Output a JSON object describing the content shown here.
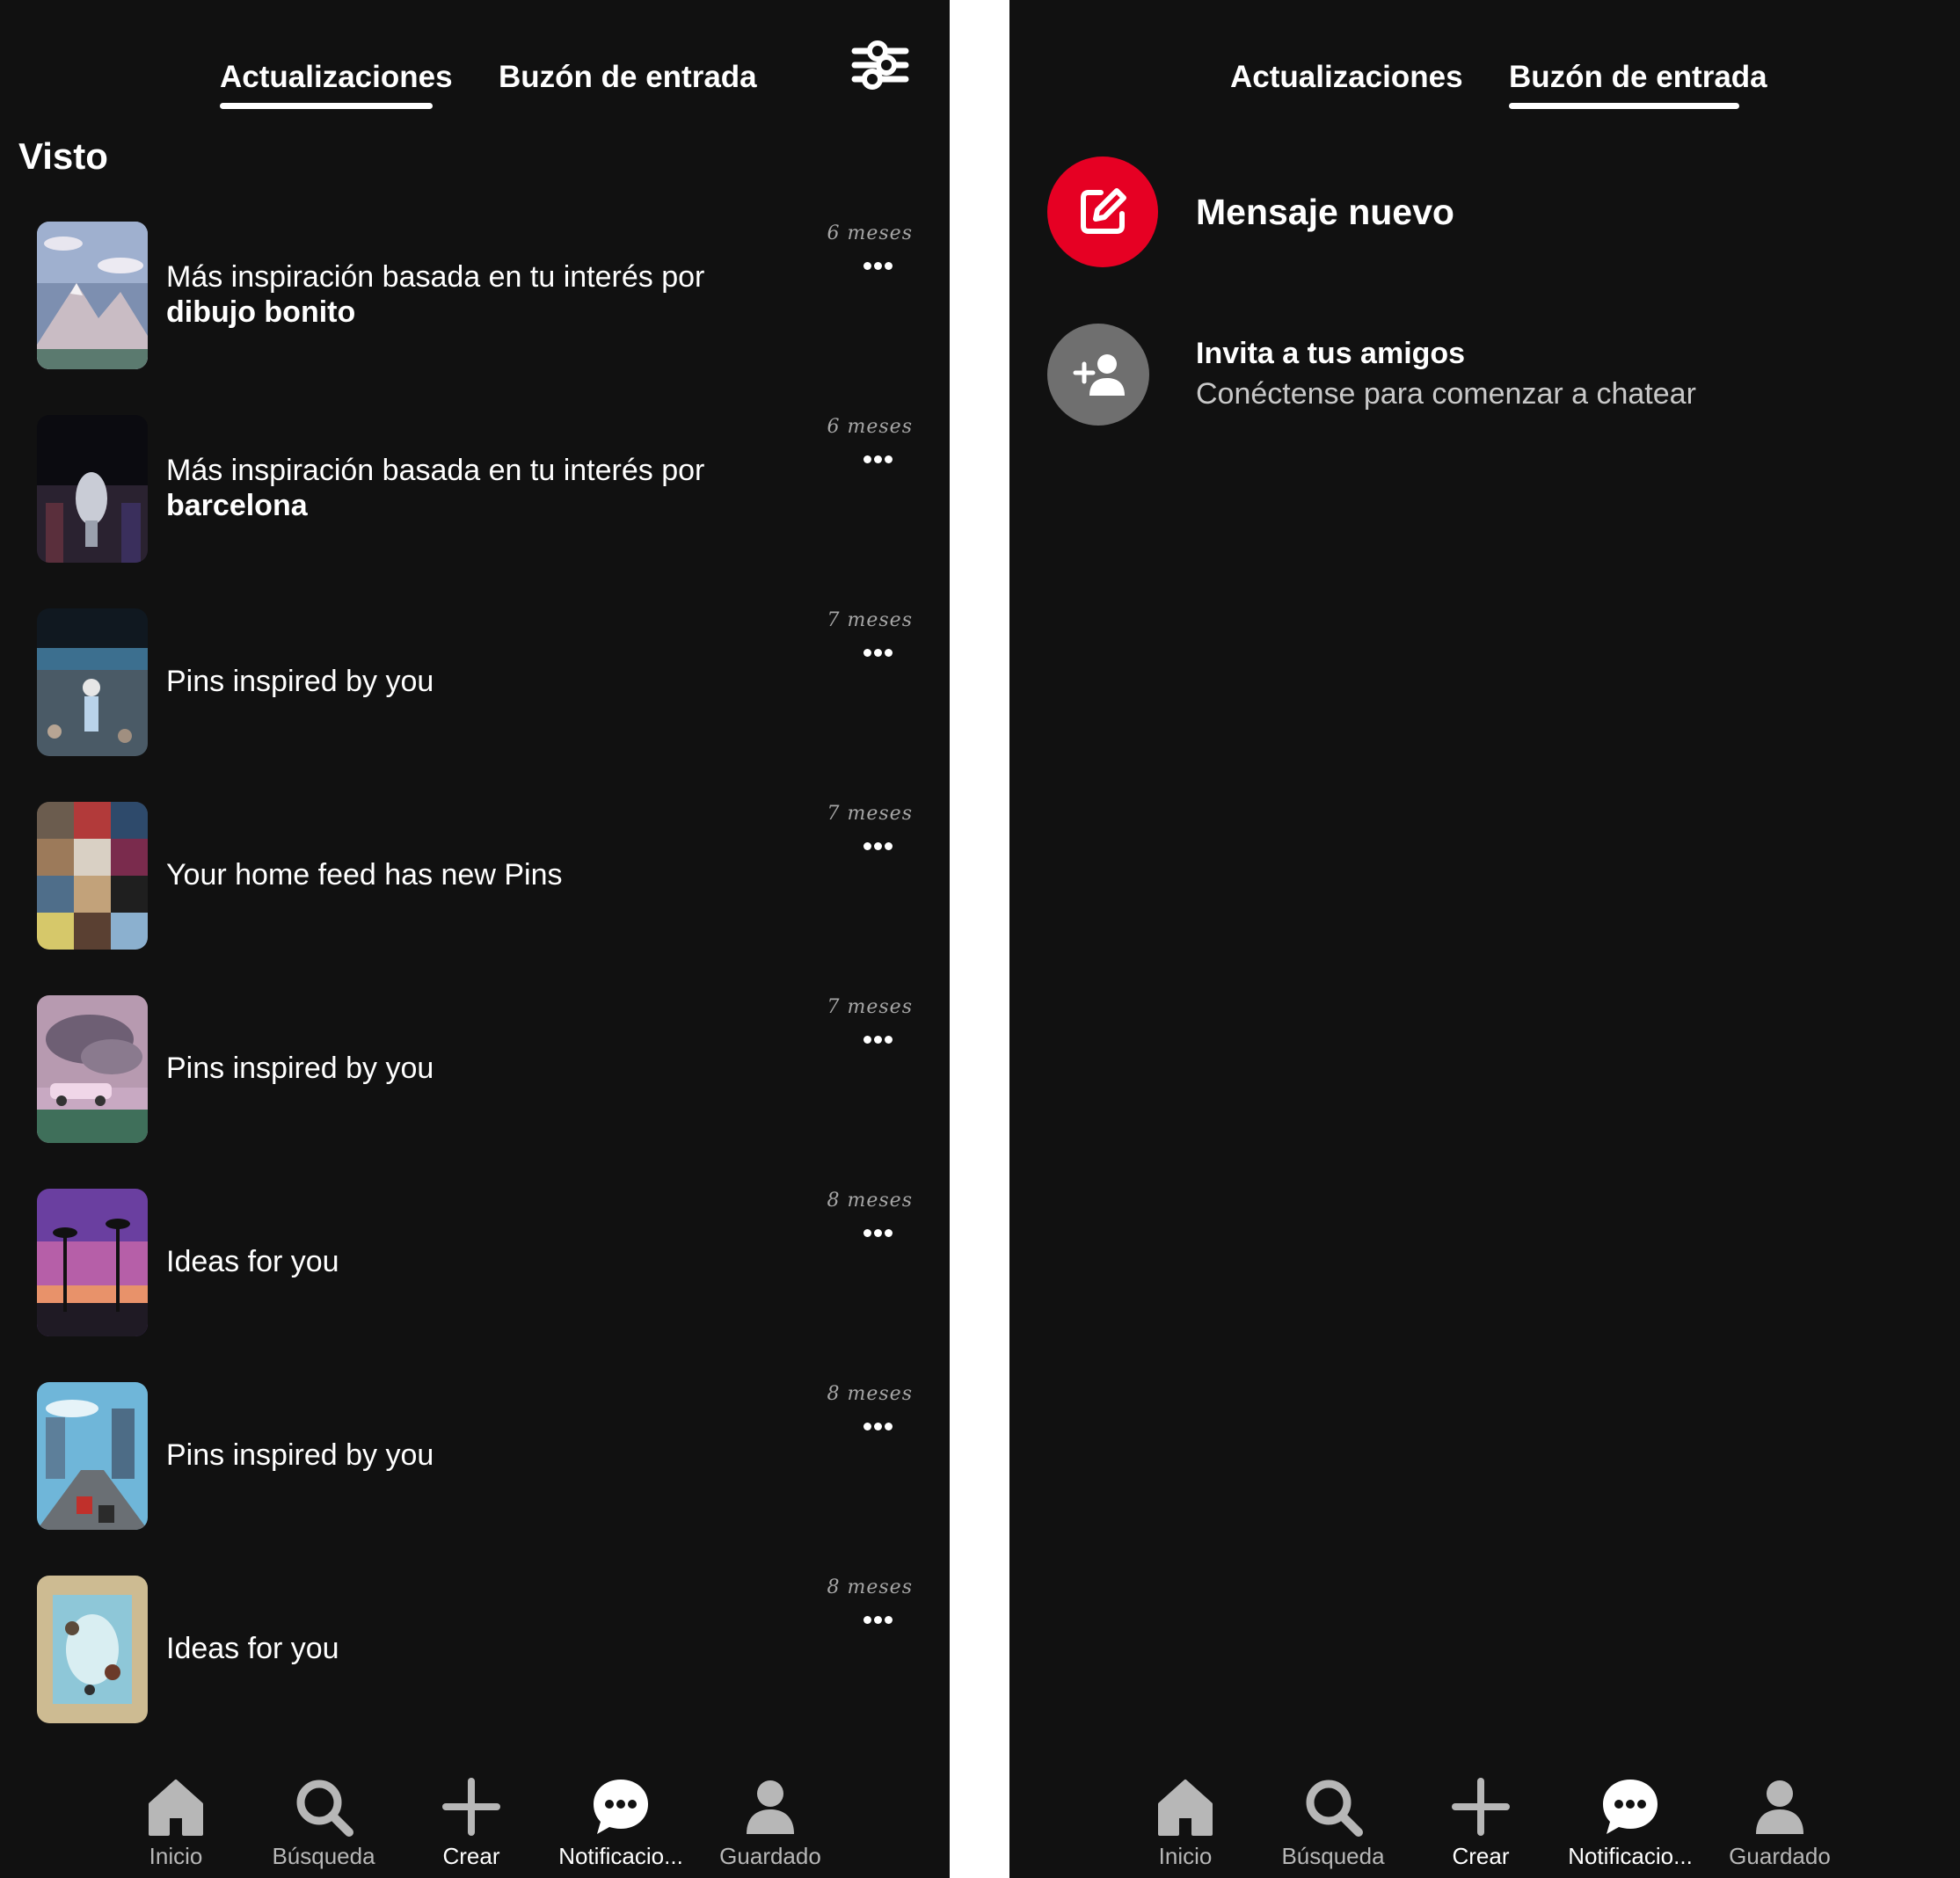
{
  "left": {
    "tabs": [
      {
        "label": "Actualizaciones",
        "active": true
      },
      {
        "label": "Buzón de entrada",
        "active": false
      }
    ],
    "filter_icon": "sliders-icon",
    "section_title": "Visto",
    "notifications": [
      {
        "line1": "Más inspiración basada en tu interés por",
        "line2": "dibujo bonito",
        "time": "6 meses",
        "thumb": "mountain-art"
      },
      {
        "line1": "Más inspiración basada en tu interés por",
        "line2": "barcelona",
        "time": "6 meses",
        "thumb": "trophy"
      },
      {
        "line1": "Pins inspired by you",
        "line2": "",
        "time": "7 meses",
        "thumb": "stadium"
      },
      {
        "line1": "Your home feed has new Pins",
        "line2": "",
        "time": "7 meses",
        "thumb": "collage"
      },
      {
        "line1": "Pins inspired by you",
        "line2": "",
        "time": "7 meses",
        "thumb": "pink-car"
      },
      {
        "line1": "Ideas for you",
        "line2": "",
        "time": "8 meses",
        "thumb": "purple-palms"
      },
      {
        "line1": "Pins inspired by you",
        "line2": "",
        "time": "8 meses",
        "thumb": "city-race"
      },
      {
        "line1": "Ideas for you",
        "line2": "",
        "time": "8 meses",
        "thumb": "sky-art"
      }
    ]
  },
  "right": {
    "tabs": [
      {
        "label": "Actualizaciones",
        "active": false
      },
      {
        "label": "Buzón de entrada",
        "active": true
      }
    ],
    "new_message": {
      "label": "Mensaje nuevo",
      "icon": "compose-icon"
    },
    "invite": {
      "title": "Invita a tus amigos",
      "subtitle": "Conéctense para comenzar a chatear",
      "icon": "add-person-icon"
    }
  },
  "nav": [
    {
      "label": "Inicio",
      "icon": "home-icon",
      "active": false
    },
    {
      "label": "Búsqueda",
      "icon": "search-icon",
      "active": false
    },
    {
      "label": "Crear",
      "icon": "plus-icon",
      "active": true
    },
    {
      "label": "Notificacio...",
      "icon": "chat-bubble-icon",
      "active": true
    },
    {
      "label": "Guardado",
      "icon": "profile-icon",
      "active": false
    }
  ],
  "colors": {
    "background": "#111111",
    "accent": "#e60023",
    "muted_text": "#a6a6a6"
  }
}
